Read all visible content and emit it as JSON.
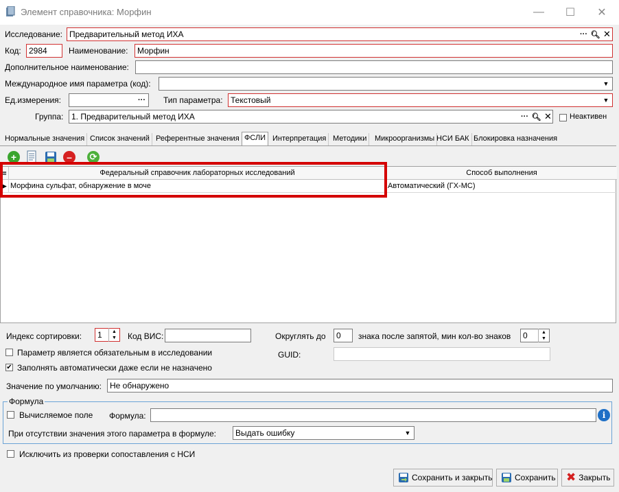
{
  "window": {
    "title": "Элемент справочника: Морфин"
  },
  "form": {
    "study_label": "Исследование:",
    "study_value": "Предварительный метод ИХА",
    "code_label": "Код:",
    "code_value": "2984",
    "name_label": "Наименование:",
    "name_value": "Морфин",
    "extra_name_label": "Дополнительное наименование:",
    "extra_name_value": "",
    "intl_name_label": "Международное имя параметра (код):",
    "intl_name_value": "",
    "unit_label": "Ед.измерения:",
    "unit_value": "",
    "param_type_label": "Тип параметра:",
    "param_type_value": "Текстовый",
    "group_label": "Группа:",
    "group_value": "1. Предварительный метод ИХА",
    "inactive_label": "Неактивен",
    "ellipsis": "···"
  },
  "tabs": [
    "Нормальные значения",
    "Список значений",
    "Референтные значения",
    "ФСЛИ",
    "Интерпретация",
    "Методики",
    "Микроорганизмы",
    "НСИ БАК",
    "Блокировка назначения"
  ],
  "active_tab": "ФСЛИ",
  "grid": {
    "columns": [
      "Федеральный справочник лабораторных исследований",
      "Способ выполнения"
    ],
    "rows": [
      {
        "fsli": "Морфина сульфат, обнаружение в моче",
        "method": "Автоматический (ГХ-МС)"
      }
    ]
  },
  "bottom": {
    "sort_index_label": "Индекс сортировки:",
    "sort_index_value": "1",
    "vis_code_label": "Код ВИС:",
    "vis_code_value": "",
    "round_label": "Округлять до",
    "round_value": "0",
    "round_suffix": "знака после запятой, мин кол-во знаков",
    "min_digits_value": "0",
    "required_label": "Параметр является обязательным в исследовании",
    "autofill_label": "Заполнять автоматически даже если не назначено",
    "guid_label": "GUID:",
    "guid_value": "",
    "default_label": "Значение по умолчанию:",
    "default_value": "Не обнаружено",
    "formula_group": "Формула",
    "computed_label": "Вычисляемое поле",
    "formula_label": "Формула:",
    "formula_value": "",
    "missing_label": "При отсутствии значения этого параметра в формуле:",
    "missing_value": "Выдать ошибку",
    "exclude_label": "Исключить из проверки сопоставления с НСИ"
  },
  "buttons": {
    "save_close": "Сохранить и закрыть",
    "save": "Сохранить",
    "close": "Закрыть"
  }
}
